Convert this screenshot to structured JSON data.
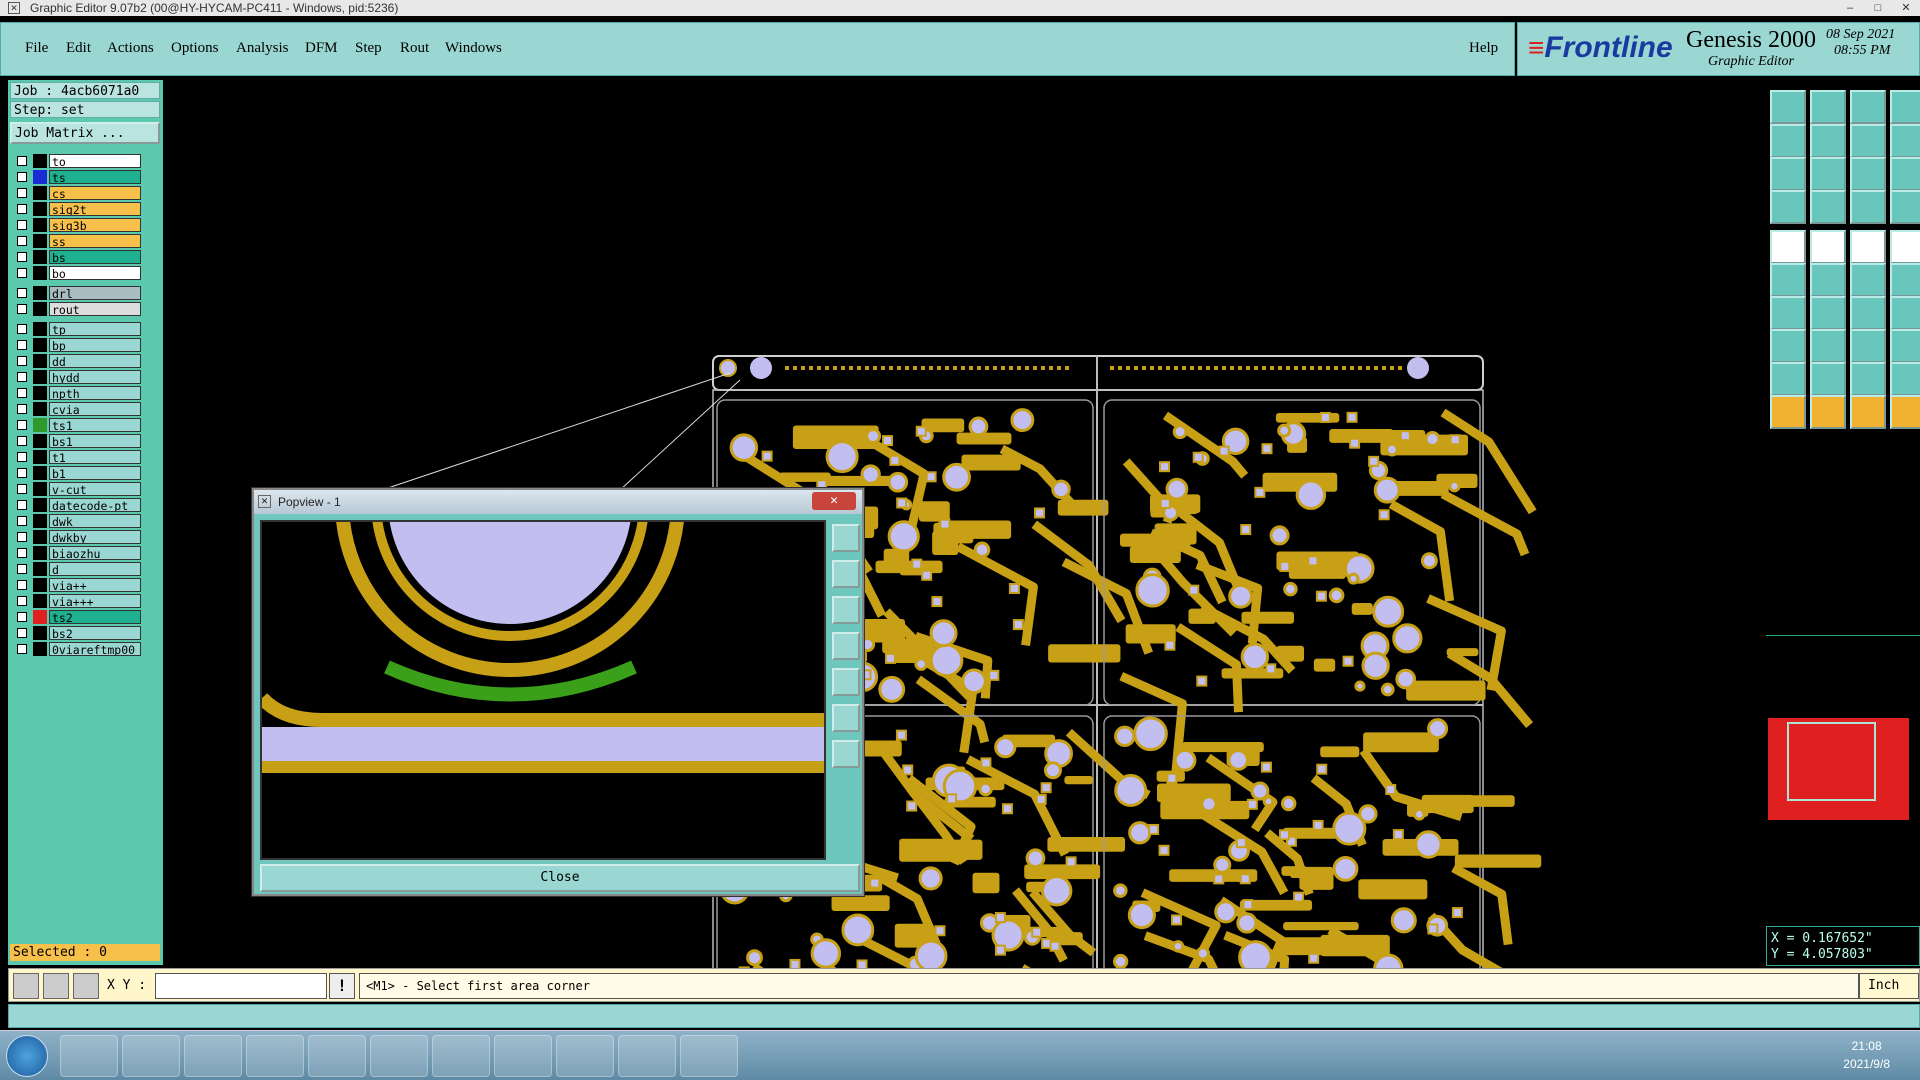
{
  "window": {
    "title": "Graphic Editor 9.07b2 (00@HY-HYCAM-PC411 - Windows, pid:5236)"
  },
  "menu": [
    "File",
    "Edit",
    "Actions",
    "Options",
    "Analysis",
    "DFM",
    "Step",
    "Rout",
    "Windows"
  ],
  "help_label": "Help",
  "brand": {
    "logo": "Frontline",
    "product": "Genesis 2000",
    "subtitle": "Graphic Editor",
    "date": "08 Sep 2021",
    "time": "08:55 PM"
  },
  "job": {
    "job_label": "Job : 4acb6071a0",
    "step_label": "Step: set",
    "matrix_button": "Job Matrix ..."
  },
  "layers": [
    {
      "name": "to",
      "swatch": "#000000",
      "bg": "#ffffff"
    },
    {
      "name": "ts",
      "swatch": "#1a2bd4",
      "bg": "#1fb08f"
    },
    {
      "name": "cs",
      "swatch": "#000000",
      "bg": "#f7c04a"
    },
    {
      "name": "sig2t",
      "swatch": "#000000",
      "bg": "#f7c04a"
    },
    {
      "name": "sig3b",
      "swatch": "#000000",
      "bg": "#f7c04a"
    },
    {
      "name": "ss",
      "swatch": "#000000",
      "bg": "#f7c04a"
    },
    {
      "name": "bs",
      "swatch": "#000000",
      "bg": "#1fb08f"
    },
    {
      "name": "bo",
      "swatch": "#000000",
      "bg": "#ffffff"
    },
    {
      "name": "drl",
      "swatch": "#000000",
      "bg": "#a9bcc0"
    },
    {
      "name": "rout",
      "swatch": "#000000",
      "bg": "#dddddd"
    },
    {
      "name": "tp",
      "swatch": "#000000",
      "bg": "#9ad7d2"
    },
    {
      "name": "bp",
      "swatch": "#000000",
      "bg": "#9ad7d2"
    },
    {
      "name": "dd",
      "swatch": "#000000",
      "bg": "#9ad7d2"
    },
    {
      "name": "hydd",
      "swatch": "#000000",
      "bg": "#9ad7d2"
    },
    {
      "name": "npth",
      "swatch": "#000000",
      "bg": "#9ad7d2"
    },
    {
      "name": "cvia",
      "swatch": "#000000",
      "bg": "#9ad7d2"
    },
    {
      "name": "ts1",
      "swatch": "#2e9a2e",
      "bg": "#9ad7d2"
    },
    {
      "name": "bs1",
      "swatch": "#000000",
      "bg": "#9ad7d2"
    },
    {
      "name": "t1",
      "swatch": "#000000",
      "bg": "#9ad7d2"
    },
    {
      "name": "b1",
      "swatch": "#000000",
      "bg": "#9ad7d2"
    },
    {
      "name": "v-cut",
      "swatch": "#000000",
      "bg": "#9ad7d2"
    },
    {
      "name": "datecode-pt",
      "swatch": "#000000",
      "bg": "#9ad7d2"
    },
    {
      "name": "dwk",
      "swatch": "#000000",
      "bg": "#9ad7d2"
    },
    {
      "name": "dwkby",
      "swatch": "#000000",
      "bg": "#9ad7d2"
    },
    {
      "name": "biaozhu",
      "swatch": "#000000",
      "bg": "#9ad7d2"
    },
    {
      "name": "d",
      "swatch": "#000000",
      "bg": "#9ad7d2"
    },
    {
      "name": "via++",
      "swatch": "#000000",
      "bg": "#9ad7d2"
    },
    {
      "name": "via+++",
      "swatch": "#000000",
      "bg": "#9ad7d2"
    },
    {
      "name": "ts2",
      "swatch": "#e02020",
      "bg": "#1fb08f"
    },
    {
      "name": "bs2",
      "swatch": "#000000",
      "bg": "#9ad7d2"
    },
    {
      "name": "0viareftmp00",
      "swatch": "#000000",
      "bg": "#9ad7d2"
    }
  ],
  "selected_label": "Selected : 0",
  "popup": {
    "title": "Popview - 1",
    "close_label": "Close"
  },
  "coords": {
    "x": "X = 0.167652\"",
    "y": "Y = 4.057803\""
  },
  "status": {
    "xy_label": "X Y :",
    "xy_value": "",
    "excl": "!",
    "prompt": "<M1> - Select first area corner",
    "units": "Inch"
  },
  "taskbar": {
    "time": "21:08",
    "date": "2021/9/8"
  },
  "colors": {
    "copper": "#c8a016",
    "pad": "#c2bff0",
    "teal": "#5bc9ae",
    "highlight": "#e02020"
  }
}
